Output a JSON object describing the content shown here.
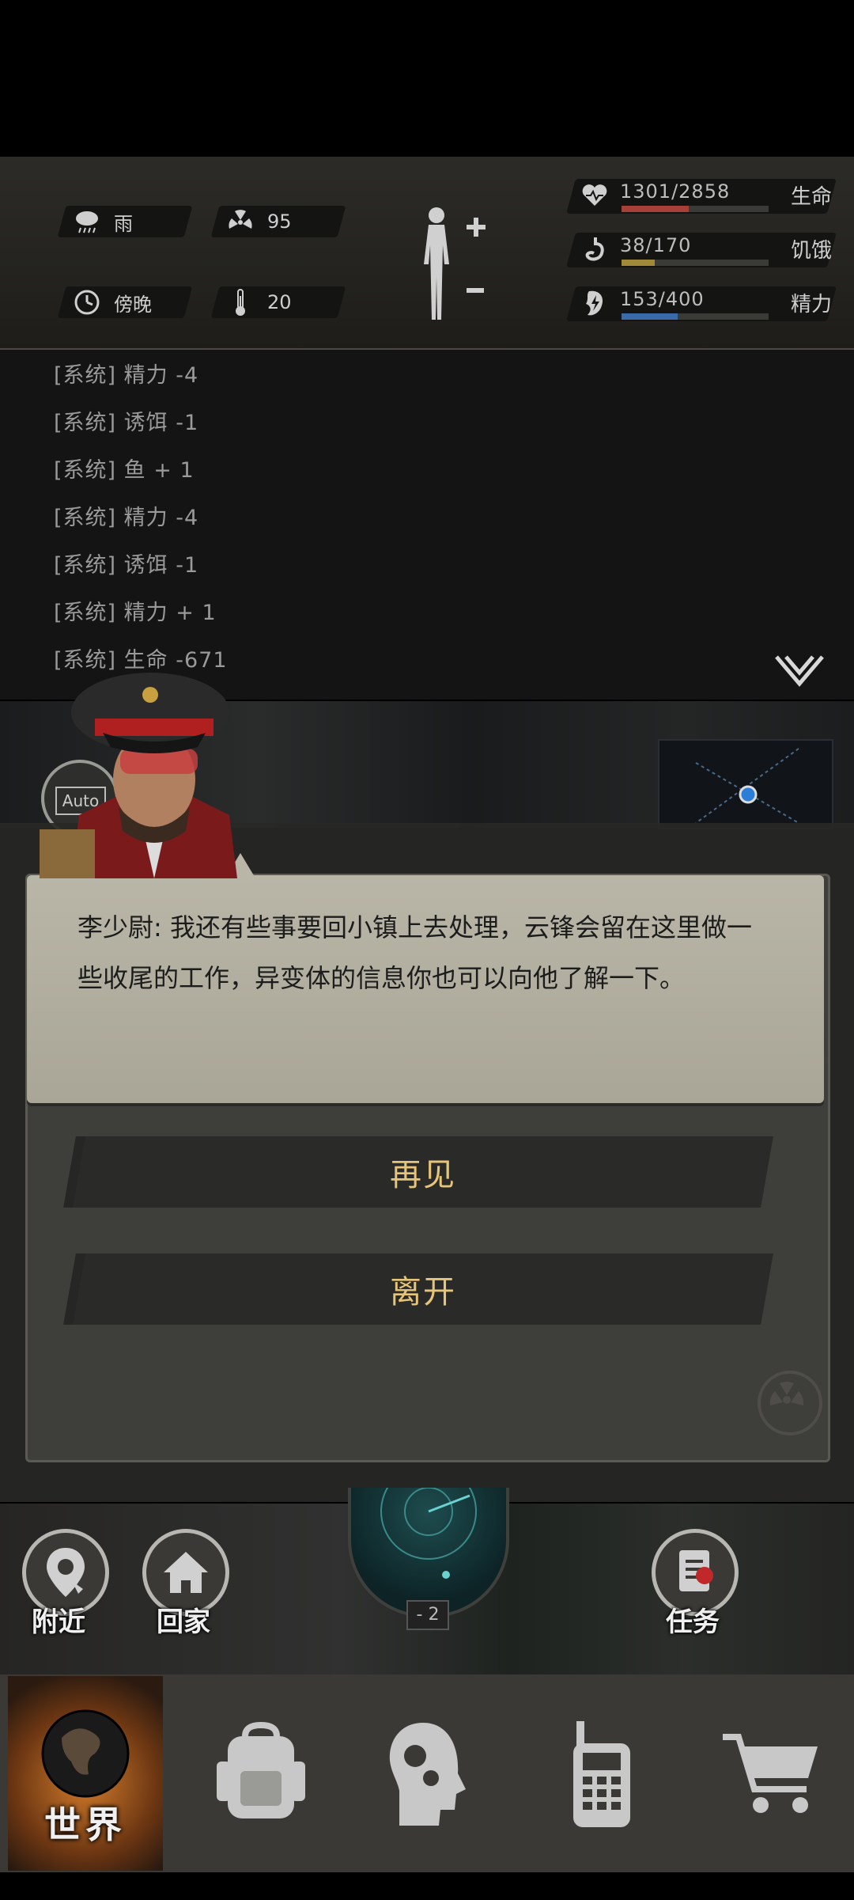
{
  "status": {
    "weather": "雨",
    "radiation": "95",
    "time_of_day": "傍晚",
    "temperature": "20"
  },
  "vitals": [
    {
      "icon": "heart-icon",
      "value": "1301/2858",
      "label": "生命",
      "fraction": 0.455,
      "color": "#a8403a"
    },
    {
      "icon": "stomach-icon",
      "value": "38/170",
      "label": "饥饿",
      "fraction": 0.224,
      "color": "#a08a3a"
    },
    {
      "icon": "energy-icon",
      "value": "153/400",
      "label": "精力",
      "fraction": 0.383,
      "color": "#3a6aa8"
    }
  ],
  "log": [
    "[系统] 精力 -4",
    "[系统] 诱饵 -1",
    "[系统] 鱼 + 1",
    "[系统] 精力 -4",
    "[系统] 诱饵 -1",
    "[系统] 精力 + 1",
    "[系统] 生命 -671"
  ],
  "dialog": {
    "speech": "李少尉: 我还有些事要回小镇上去处理，云锋会留在这里做一些收尾的工作，异变体的信息你也可以向他了解一下。",
    "choices": [
      "再见",
      "离开"
    ]
  },
  "scene": {
    "auto_label": "Auto"
  },
  "actions": {
    "nearby": "附近",
    "home": "回家",
    "radar_count": "- 2",
    "tasks": "任务"
  },
  "nav": {
    "world": "世界"
  }
}
